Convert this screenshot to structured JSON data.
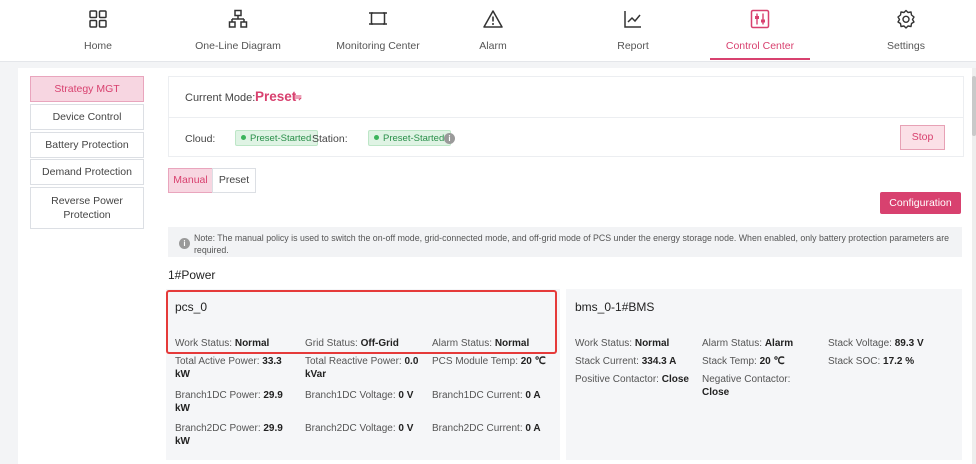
{
  "nav": {
    "items": [
      {
        "label": "Home",
        "icon": "grid-icon"
      },
      {
        "label": "One-Line Diagram",
        "icon": "hierarchy-icon"
      },
      {
        "label": "Monitoring Center",
        "icon": "monitor-icon"
      },
      {
        "label": "Alarm",
        "icon": "warning-icon"
      },
      {
        "label": "Report",
        "icon": "chart-icon"
      },
      {
        "label": "Control Center",
        "icon": "control-icon"
      },
      {
        "label": "Settings",
        "icon": "gear-icon"
      }
    ],
    "active": "Control Center"
  },
  "sidebar": {
    "items": [
      {
        "label": "Strategy MGT",
        "active": true
      },
      {
        "label": "Device Control",
        "active": false
      },
      {
        "label": "Battery Protection",
        "active": false
      },
      {
        "label": "Demand Protection",
        "active": false
      },
      {
        "label": "Reverse Power Protection",
        "active": false
      }
    ]
  },
  "mode": {
    "label": "Current Mode:",
    "value": "Preset",
    "switch_icon": "⇋"
  },
  "status": {
    "cloud_label": "Cloud:",
    "cloud_value": "Preset-Started",
    "station_label": "Station:",
    "station_value": "Preset-Started",
    "stop_label": "Stop"
  },
  "tabs": [
    {
      "label": "Manual",
      "active": true
    },
    {
      "label": "Preset",
      "active": false
    }
  ],
  "configuration_label": "Configuration",
  "note": "Note: The manual policy is used to switch the on-off mode, grid-connected mode, and off-grid mode of PCS under the energy storage node. When enabled, only battery protection parameters are required.",
  "section_title": "1#Power",
  "pcs": {
    "title": "pcs_0",
    "work_status_label": "Work Status:",
    "work_status": "Normal",
    "grid_status_label": "Grid Status:",
    "grid_status": "Off-Grid",
    "alarm_status_label": "Alarm Status:",
    "alarm_status": "Normal",
    "total_active_power_label": "Total Active Power:",
    "total_active_power": "33.3",
    "total_active_power_unit": "kW",
    "total_reactive_power_label": "Total Reactive Power:",
    "total_reactive_power": "0.0",
    "total_reactive_power_unit": "kVar",
    "module_temp_label": "PCS Module Temp:",
    "module_temp": "20 ℃",
    "b1_power_label": "Branch1DC Power:",
    "b1_power": "29.9",
    "b1_power_unit": "kW",
    "b1_voltage_label": "Branch1DC Voltage:",
    "b1_voltage": "0 V",
    "b1_current_label": "Branch1DC Current:",
    "b1_current": "0 A",
    "b2_power_label": "Branch2DC Power:",
    "b2_power": "29.9",
    "b2_power_unit": "kW",
    "b2_voltage_label": "Branch2DC Voltage:",
    "b2_voltage": "0 V",
    "b2_current_label": "Branch2DC Current:",
    "b2_current": "0 A"
  },
  "bms": {
    "title": "bms_0-1#BMS",
    "work_status_label": "Work Status:",
    "work_status": "Normal",
    "alarm_status_label": "Alarm Status:",
    "alarm_status": "Alarm",
    "stack_voltage_label": "Stack Voltage:",
    "stack_voltage": "89.3 V",
    "stack_current_label": "Stack Current:",
    "stack_current": "334.3 A",
    "stack_temp_label": "Stack Temp:",
    "stack_temp": "20 ℃",
    "stack_soc_label": "Stack SOC:",
    "stack_soc": "17.2 %",
    "pos_contactor_label": "Positive Contactor:",
    "pos_contactor": "Close",
    "neg_contactor_label": "Negative Contactor:",
    "neg_contactor": "Close"
  },
  "colors": {
    "accent": "#d8416f",
    "status_green": "#3bb45b",
    "highlight_red": "#e53a3a"
  }
}
